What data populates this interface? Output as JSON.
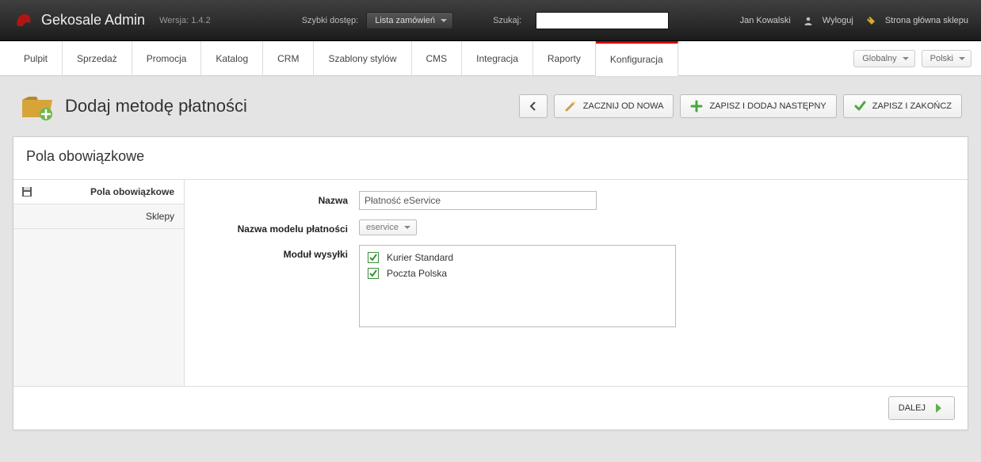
{
  "brand": {
    "title": "Gekosale Admin",
    "version": "Wersja: 1.4.2"
  },
  "top": {
    "quick_label": "Szybki dostęp:",
    "quick_value": "Lista zamówień",
    "search_label": "Szukaj:",
    "search_value": "",
    "user_name": "Jan Kowalski",
    "logout": "Wyloguj",
    "home": "Strona główna sklepu"
  },
  "nav": {
    "tabs": [
      {
        "label": "Pulpit"
      },
      {
        "label": "Sprzedaż"
      },
      {
        "label": "Promocja"
      },
      {
        "label": "Katalog"
      },
      {
        "label": "CRM"
      },
      {
        "label": "Szablony stylów"
      },
      {
        "label": "CMS"
      },
      {
        "label": "Integracja"
      },
      {
        "label": "Raporty"
      },
      {
        "label": "Konfiguracja"
      }
    ],
    "scope_value": "Globalny",
    "lang_value": "Polski"
  },
  "page": {
    "title": "Dodaj metodę płatności",
    "actions": {
      "restart": "ZACZNIJ OD NOWA",
      "save_next": "ZAPISZ I DODAJ NASTĘPNY",
      "save_close": "ZAPISZ I ZAKOŃCZ"
    }
  },
  "panel": {
    "header": "Pola obowiązkowe",
    "sidebar": {
      "item_required": "Pola obowiązkowe",
      "item_shops": "Sklepy"
    },
    "form": {
      "name_label": "Nazwa",
      "name_value": "Płatność eService",
      "model_label": "Nazwa modelu płatności",
      "model_value": "eservice",
      "ship_label": "Moduł wysyłki",
      "ship_options": [
        {
          "label": "Kurier Standard"
        },
        {
          "label": "Poczta Polska"
        }
      ]
    },
    "footer_next": "DALEJ"
  }
}
